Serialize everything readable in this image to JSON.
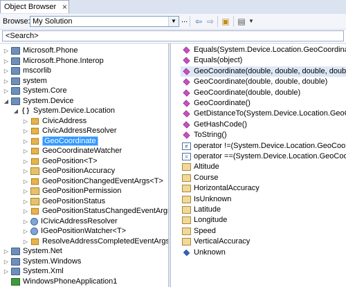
{
  "tab": {
    "title": "Object Browser",
    "close_glyph": "×"
  },
  "toolbar": {
    "browse_label": "Browse:",
    "browse_value": "My Solution",
    "browse_more": "...",
    "buttons": [
      "back-icon",
      "forward-icon",
      "add-reference-icon",
      "settings-icon"
    ]
  },
  "search": {
    "value": "<Search>"
  },
  "tree": [
    {
      "label": "Microsoft.Phone",
      "depth": 0,
      "kind": "assembly",
      "expander": "▷"
    },
    {
      "label": "Microsoft.Phone.Interop",
      "depth": 0,
      "kind": "assembly",
      "expander": "▷"
    },
    {
      "label": "mscorlib",
      "depth": 0,
      "kind": "assembly",
      "expander": "▷"
    },
    {
      "label": "system",
      "depth": 0,
      "kind": "assembly",
      "expander": "▷"
    },
    {
      "label": "System.Core",
      "depth": 0,
      "kind": "assembly",
      "expander": "▷"
    },
    {
      "label": "System.Device",
      "depth": 0,
      "kind": "assembly",
      "expander": "◢"
    },
    {
      "label": "System.Device.Location",
      "depth": 1,
      "kind": "namespace",
      "expander": "◢"
    },
    {
      "label": "CivicAddress",
      "depth": 2,
      "kind": "class",
      "expander": "▷"
    },
    {
      "label": "CivicAddressResolver",
      "depth": 2,
      "kind": "class",
      "expander": "▷"
    },
    {
      "label": "GeoCoordinate",
      "depth": 2,
      "kind": "class",
      "expander": "▷",
      "selected": true
    },
    {
      "label": "GeoCoordinateWatcher",
      "depth": 2,
      "kind": "class",
      "expander": "▷"
    },
    {
      "label": "GeoPosition<T>",
      "depth": 2,
      "kind": "class",
      "expander": "▷"
    },
    {
      "label": "GeoPositionAccuracy",
      "depth": 2,
      "kind": "enum",
      "expander": "▷"
    },
    {
      "label": "GeoPositionChangedEventArgs<T>",
      "depth": 2,
      "kind": "class",
      "expander": "▷"
    },
    {
      "label": "GeoPositionPermission",
      "depth": 2,
      "kind": "enum",
      "expander": "▷"
    },
    {
      "label": "GeoPositionStatus",
      "depth": 2,
      "kind": "enum",
      "expander": "▷"
    },
    {
      "label": "GeoPositionStatusChangedEventArgs",
      "depth": 2,
      "kind": "class",
      "expander": "▷"
    },
    {
      "label": "ICivicAddressResolver",
      "depth": 2,
      "kind": "interface",
      "expander": "▷"
    },
    {
      "label": "IGeoPositionWatcher<T>",
      "depth": 2,
      "kind": "interface",
      "expander": "▷"
    },
    {
      "label": "ResolveAddressCompletedEventArgs",
      "depth": 2,
      "kind": "class",
      "expander": "▷"
    },
    {
      "label": "System.Net",
      "depth": 0,
      "kind": "assembly",
      "expander": "▷"
    },
    {
      "label": "System.Windows",
      "depth": 0,
      "kind": "assembly",
      "expander": "▷"
    },
    {
      "label": "System.Xml",
      "depth": 0,
      "kind": "assembly",
      "expander": "▷"
    },
    {
      "label": "WindowsPhoneApplication1",
      "depth": 0,
      "kind": "project",
      "expander": ""
    }
  ],
  "members": [
    {
      "label": "Equals(System.Device.Location.GeoCoordinate)",
      "kind": "method"
    },
    {
      "label": "Equals(object)",
      "kind": "method"
    },
    {
      "label": "GeoCoordinate(double, double, double, double, double, dou",
      "kind": "method",
      "highlight": true
    },
    {
      "label": "GeoCoordinate(double, double, double)",
      "kind": "method"
    },
    {
      "label": "GeoCoordinate(double, double)",
      "kind": "method"
    },
    {
      "label": "GeoCoordinate()",
      "kind": "method"
    },
    {
      "label": "GetDistanceTo(System.Device.Location.GeoCoordinat",
      "kind": "method"
    },
    {
      "label": "GetHashCode()",
      "kind": "method"
    },
    {
      "label": "ToString()",
      "kind": "method"
    },
    {
      "label": "operator !=(System.Device.Location.GeoCoordinate,",
      "kind": "operator",
      "glyph": "≠"
    },
    {
      "label": "operator ==(System.Device.Location.GeoCoordinat",
      "kind": "operator",
      "glyph": "="
    },
    {
      "label": "Altitude",
      "kind": "property"
    },
    {
      "label": "Course",
      "kind": "property"
    },
    {
      "label": "HorizontalAccuracy",
      "kind": "property"
    },
    {
      "label": "IsUnknown",
      "kind": "property"
    },
    {
      "label": "Latitude",
      "kind": "property"
    },
    {
      "label": "Longitude",
      "kind": "property"
    },
    {
      "label": "Speed",
      "kind": "property"
    },
    {
      "label": "VerticalAccuracy",
      "kind": "property"
    },
    {
      "label": "Unknown",
      "kind": "field"
    }
  ]
}
